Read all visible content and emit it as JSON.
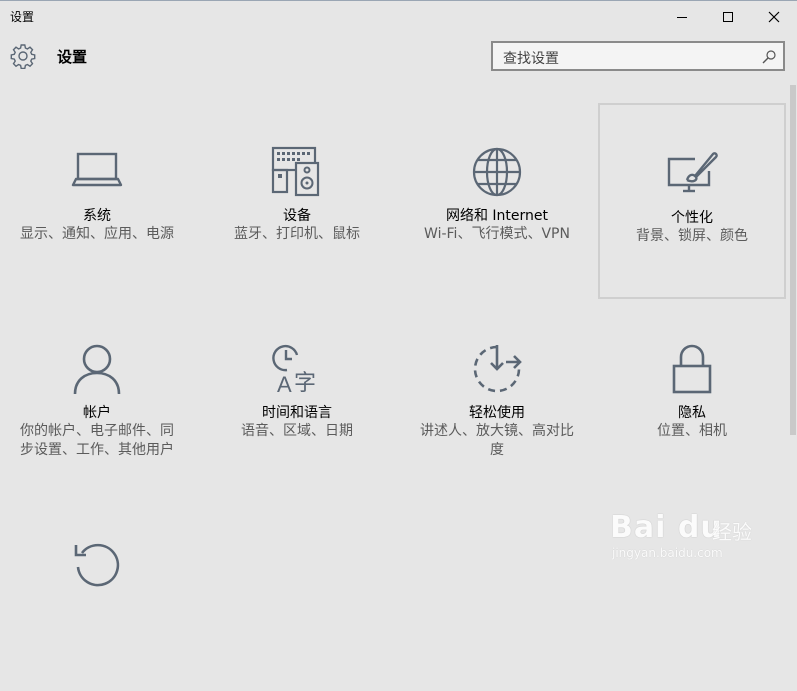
{
  "window": {
    "title": "设置",
    "controls": {
      "minimize": "minimize-icon",
      "maximize": "maximize-icon",
      "close": "close-icon"
    }
  },
  "header": {
    "icon": "gear-icon",
    "title": "设置"
  },
  "search": {
    "placeholder": "查找设置",
    "icon": "search-icon"
  },
  "tiles": [
    {
      "label": "系统",
      "desc": "显示、通知、应用、电源",
      "icon": "laptop-icon"
    },
    {
      "label": "设备",
      "desc": "蓝牙、打印机、鼠标",
      "icon": "keyboard-speaker-icon"
    },
    {
      "label": "网络和 Internet",
      "desc": "Wi-Fi、飞行模式、VPN",
      "icon": "globe-icon"
    },
    {
      "label": "个性化",
      "desc": "背景、锁屏、颜色",
      "icon": "paint-monitor-icon"
    },
    {
      "label": "帐户",
      "desc": "你的帐户、电子邮件、同步设置、工作、其他用户",
      "icon": "person-icon"
    },
    {
      "label": "时间和语言",
      "desc": "语音、区域、日期",
      "icon": "clock-language-icon"
    },
    {
      "label": "轻松使用",
      "desc": "讲述人、放大镜、高对比度",
      "icon": "ease-of-access-icon"
    },
    {
      "label": "隐私",
      "desc": "位置、相机",
      "icon": "lock-icon"
    },
    {
      "label": "",
      "desc": "",
      "icon": "update-icon"
    }
  ],
  "selected_tile": 3,
  "colors": {
    "background": "#e6e6e6",
    "icon": "#5b6775",
    "desc": "#5b5b5b"
  },
  "watermark": {
    "brand": "Bai du",
    "text": "经验",
    "url": "jingyan.baidu.com"
  }
}
